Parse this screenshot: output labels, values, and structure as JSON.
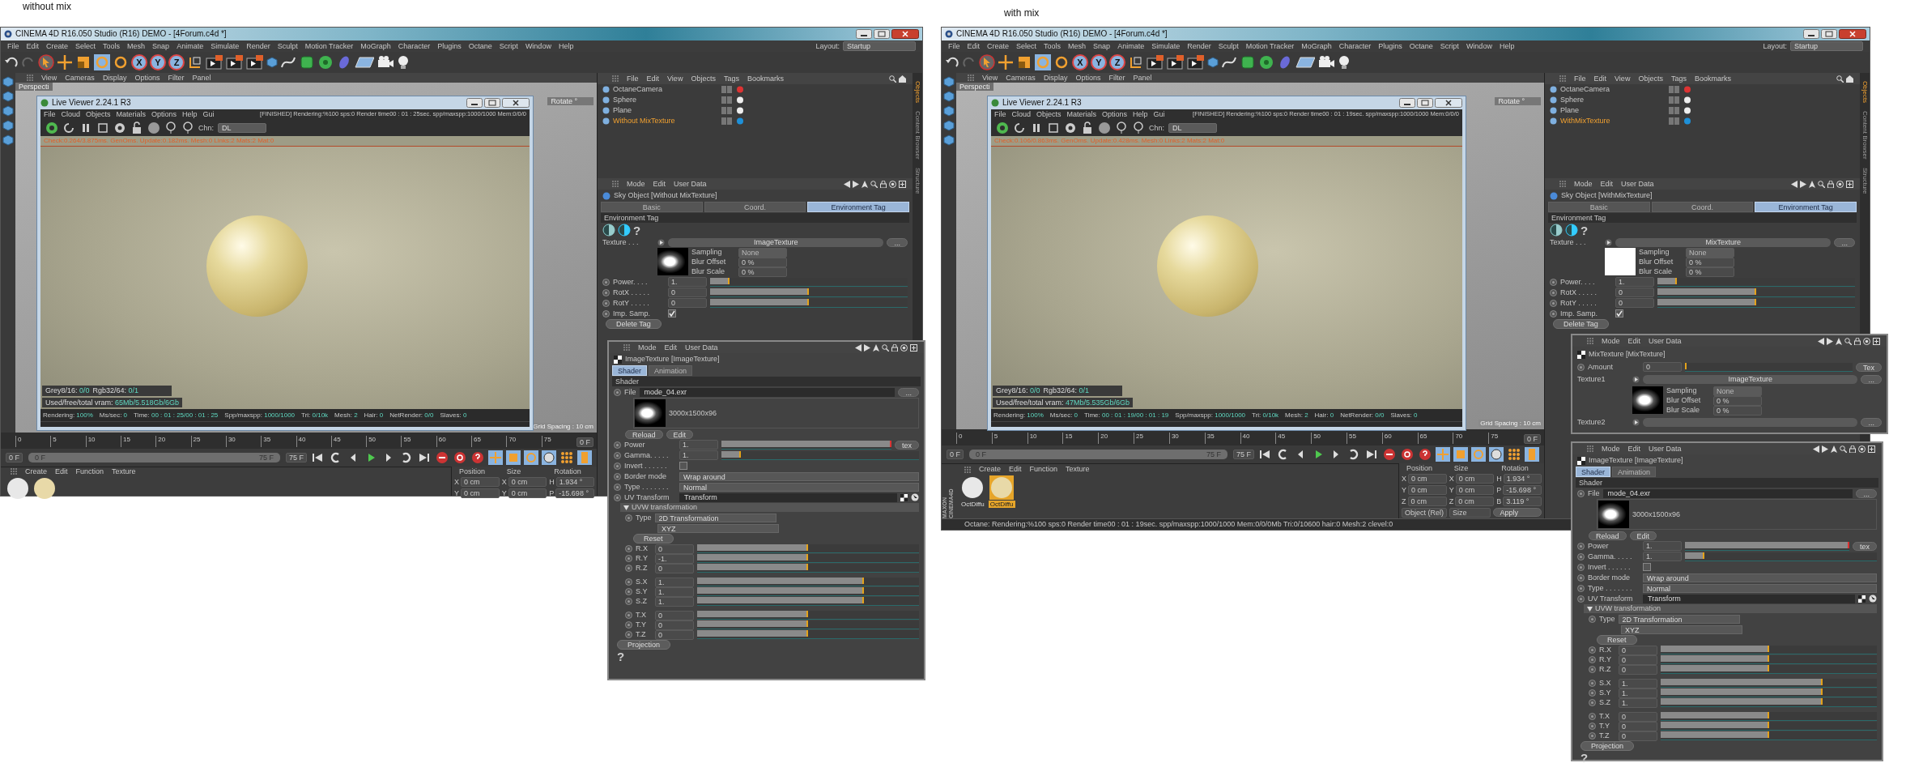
{
  "sides": [
    {
      "caption": "without mix",
      "window": {
        "title": "CINEMA 4D R16.050 Studio (R16) DEMO - [4Forum.c4d *]"
      },
      "menu": [
        "File",
        "Edit",
        "Create",
        "Select",
        "Tools",
        "Mesh",
        "Snap",
        "Animate",
        "Simulate",
        "Render",
        "Sculpt",
        "Motion Tracker",
        "MoGraph",
        "Character",
        "Plugins",
        "Octane",
        "Script",
        "Window",
        "Help"
      ],
      "layout": {
        "label": "Layout:",
        "value": "Startup"
      },
      "axes": [
        "X",
        "Y",
        "Z"
      ],
      "viewport": {
        "menu": [
          "View",
          "Cameras",
          "Display",
          "Options",
          "Filter",
          "Panel"
        ],
        "camera": "Perspecti",
        "hud": "Rotate °",
        "grid": "Grid Spacing : 10 cm"
      },
      "live_viewer": {
        "title": "Live Viewer 2.24.1 R3",
        "menu": [
          "File",
          "Cloud",
          "Objects",
          "Materials",
          "Options",
          "Help",
          "Gui"
        ],
        "status": "[FINISHED]  Rendering:%100 sps:0 Render time00 : 01 : 25sec. spp/maxspp:1000/1000 Mem:0/0/0",
        "channel_label": "Chn:",
        "channel": "DL",
        "log": "Check:0.264/3.875ms. GenOms. Update:0.182ms. Mesh:0 Links:2 Mats:2 Mat:0",
        "info": [
          {
            "label": "Grey8/16:",
            "value": "0/0"
          },
          {
            "label": "Rgb32/64:",
            "value": "0/1"
          }
        ],
        "vram": {
          "label": "Used/free/total vram:",
          "value": "65Mb/5.518Gb/6Gb"
        },
        "stats": [
          {
            "label": "Rendering:",
            "value": "100%"
          },
          {
            "label": "Ms/sec:",
            "value": "0"
          },
          {
            "label": "Time:",
            "value": "00 : 01 : 25/00 : 01 : 25"
          },
          {
            "label": "Spp/maxspp:",
            "value": "1000/1000"
          },
          {
            "label": "Tri:",
            "value": "0/10k"
          },
          {
            "label": "Mesh:",
            "value": "2"
          },
          {
            "label": "Hair:",
            "value": "0"
          },
          {
            "label": "NetRender:",
            "value": "0/0"
          },
          {
            "label": "Slaves:",
            "value": "0"
          }
        ]
      },
      "objects": {
        "menu": [
          "File",
          "Edit",
          "View",
          "Objects",
          "Tags",
          "Bookmarks"
        ],
        "items": [
          {
            "name": "OctaneCamera",
            "selected": false
          },
          {
            "name": "Sphere",
            "selected": false
          },
          {
            "name": "Plane",
            "selected": false
          },
          {
            "name": "Without MixTexture",
            "selected": true
          }
        ]
      },
      "side_tabs": [
        {
          "label": "Objects",
          "selected": true
        },
        {
          "label": "Content Browser",
          "selected": false
        },
        {
          "label": "Structure",
          "selected": false
        }
      ],
      "attributes": {
        "menu": [
          "Mode",
          "Edit",
          "User Data"
        ],
        "title": "Sky Object [Without MixTexture]",
        "tabs": [
          {
            "label": "Basic",
            "selected": false
          },
          {
            "label": "Coord.",
            "selected": false
          },
          {
            "label": "Environment Tag",
            "selected": true
          }
        ],
        "section": "Environment Tag",
        "help": "?",
        "texture": {
          "label": "Texture . . .",
          "value": "ImageTexture",
          "button": "...",
          "preview_blank": false
        },
        "sampling": [
          {
            "label": "Sampling",
            "value": "None",
            "kind": "dropdown"
          },
          {
            "label": "Blur Offset",
            "value": "0 %",
            "kind": "number"
          },
          {
            "label": "Blur Scale",
            "value": "0 %",
            "kind": "number"
          }
        ],
        "params": [
          {
            "label": "Power. . . .",
            "value": "1.",
            "level": 0.1
          },
          {
            "label": "RotX . . . . .",
            "value": "0",
            "level": 0.5
          },
          {
            "label": "RotY . . . . .",
            "value": "0",
            "level": 0.5
          }
        ],
        "imp_samp": {
          "label": "Imp. Samp.",
          "checked": true
        },
        "delete": "Delete Tag"
      },
      "timeline": {
        "ticks": [
          "0",
          "5",
          "10",
          "15",
          "20",
          "25",
          "30",
          "35",
          "40",
          "45",
          "50",
          "55",
          "60",
          "65",
          "70",
          "75"
        ],
        "current": "0 F",
        "start": "0 F",
        "range_start": "0 F",
        "range_end": "75 F",
        "end": "75 F",
        "range": {
          "level": 1
        }
      },
      "material_menu": [
        "Create",
        "Edit",
        "Function",
        "Texture"
      ],
      "materials": [
        {
          "selected": false
        },
        {
          "selected": false
        }
      ],
      "coordinates": {
        "headers": [
          "Position",
          "Size",
          "Rotation"
        ],
        "rows": [
          [
            {
              "axis": "X",
              "value": "0 cm"
            },
            {
              "axis": "X",
              "value": "0 cm"
            },
            {
              "axis": "H",
              "value": "1.934 °"
            }
          ],
          [
            {
              "axis": "Y",
              "value": "0 cm"
            },
            {
              "axis": "Y",
              "value": "0 cm"
            },
            {
              "axis": "P",
              "value": "-15.698 °"
            }
          ]
        ]
      },
      "panels": [
        {
          "kind": "image",
          "menu": [
            "Mode",
            "Edit",
            "User Data"
          ],
          "title": "ImageTexture [ImageTexture]",
          "tabs": [
            {
              "label": "Shader",
              "selected": true
            },
            {
              "label": "Animation",
              "selected": false
            }
          ],
          "section": "Shader",
          "file": {
            "label": "File",
            "value": "mode_04.exr",
            "button": "..."
          },
          "preview_caption": "3000x1500x96",
          "buttons": [
            "Reload",
            "Edit"
          ],
          "rows": [
            {
              "kind": "slider",
              "label": "Power",
              "value": "1.",
              "level": 1,
              "button": "tex"
            },
            {
              "kind": "slider",
              "label": "Gamma. . . . .",
              "value": "1.",
              "level": 0.1
            },
            {
              "kind": "checkbox",
              "label": "Invert . . . . . .",
              "checked": false
            },
            {
              "kind": "dropdown",
              "label": "Border mode",
              "value": "Wrap around"
            },
            {
              "kind": "dropdown",
              "label": "Type . . . . . . .",
              "value": "Normal"
            },
            {
              "kind": "link",
              "label": "UV Transform",
              "value": "Transform"
            }
          ],
          "group": {
            "title": "UVW transformation",
            "expanded": true,
            "type_label": "Type",
            "type": "2D Transformation",
            "order": "XYZ",
            "reset": "Reset",
            "rows": [
              {
                "label": "R.X",
                "value": "0",
                "level": 0.5
              },
              {
                "label": "R.Y",
                "value": "-1.",
                "level": 0.5
              },
              {
                "label": "R.Z",
                "value": "0",
                "level": 0.5
              },
              {
                "label": "S.X",
                "value": "1.",
                "level": 0.75
              },
              {
                "label": "S.Y",
                "value": "1.",
                "level": 0.75
              },
              {
                "label": "S.Z",
                "value": "1.",
                "level": 0.75
              },
              {
                "label": "T.X",
                "value": "0",
                "level": 0.5
              },
              {
                "label": "T.Y",
                "value": "0",
                "level": 0.5
              },
              {
                "label": "T.Z",
                "value": "0",
                "level": 0.5
              }
            ]
          },
          "projection": "Projection",
          "help": "?"
        }
      ]
    },
    {
      "caption": "with mix",
      "window": {
        "title": "CINEMA 4D R16.050 Studio (R16) DEMO - [4Forum.c4d *]"
      },
      "menu": [
        "File",
        "Edit",
        "Create",
        "Select",
        "Tools",
        "Mesh",
        "Snap",
        "Animate",
        "Simulate",
        "Render",
        "Sculpt",
        "Motion Tracker",
        "MoGraph",
        "Character",
        "Plugins",
        "Octane",
        "Script",
        "Window",
        "Help"
      ],
      "layout": {
        "label": "Layout:",
        "value": "Startup"
      },
      "axes": [
        "X",
        "Y",
        "Z"
      ],
      "viewport": {
        "menu": [
          "View",
          "Cameras",
          "Display",
          "Options",
          "Filter",
          "Panel"
        ],
        "camera": "Perspecti",
        "hud": "Rotate °",
        "grid": "Grid Spacing : 10 cm"
      },
      "live_viewer": {
        "title": "Live Viewer 2.24.1 R3",
        "menu": [
          "File",
          "Cloud",
          "Objects",
          "Materials",
          "Options",
          "Help",
          "Gui"
        ],
        "status": "[FINISHED]  Rendering:%100 sps:0 Render time00 : 01 : 19sec. spp/maxspp:1000/1000 Mem:0/0/0",
        "channel_label": "Chn:",
        "channel": "DL",
        "log": "Check:0.106/0.863ms. GenOms. Update:0.428ms. Mesh:0 Links:2 Mats:2 Mat:0",
        "info": [
          {
            "label": "Grey8/16:",
            "value": "0/0"
          },
          {
            "label": "Rgb32/64:",
            "value": "0/1"
          }
        ],
        "vram": {
          "label": "Used/free/total vram:",
          "value": "47Mb/5.535Gb/6Gb"
        },
        "stats": [
          {
            "label": "Rendering:",
            "value": "100%"
          },
          {
            "label": "Ms/sec:",
            "value": "0"
          },
          {
            "label": "Time:",
            "value": "00 : 01 : 19/00 : 01 : 19"
          },
          {
            "label": "Spp/maxspp:",
            "value": "1000/1000"
          },
          {
            "label": "Tri:",
            "value": "0/10k"
          },
          {
            "label": "Mesh:",
            "value": "2"
          },
          {
            "label": "Hair:",
            "value": "0"
          },
          {
            "label": "NetRender:",
            "value": "0/0"
          },
          {
            "label": "Slaves:",
            "value": "0"
          }
        ]
      },
      "objects": {
        "menu": [
          "File",
          "Edit",
          "View",
          "Objects",
          "Tags",
          "Bookmarks"
        ],
        "items": [
          {
            "name": "OctaneCamera",
            "selected": false
          },
          {
            "name": "Sphere",
            "selected": false
          },
          {
            "name": "Plane",
            "selected": false
          },
          {
            "name": "WithMixTexture",
            "selected": true
          }
        ]
      },
      "side_tabs": [
        {
          "label": "Objects",
          "selected": true
        },
        {
          "label": "Content Browser",
          "selected": false
        },
        {
          "label": "Structure",
          "selected": false
        }
      ],
      "attributes": {
        "menu": [
          "Mode",
          "Edit",
          "User Data"
        ],
        "title": "Sky Object [WithMixTexture]",
        "tabs": [
          {
            "label": "Basic",
            "selected": false
          },
          {
            "label": "Coord.",
            "selected": false
          },
          {
            "label": "Environment Tag",
            "selected": true
          }
        ],
        "section": "Environment Tag",
        "help": "?",
        "texture": {
          "label": "Texture . . .",
          "value": "MixTexture",
          "button": "...",
          "preview_blank": true
        },
        "sampling": [
          {
            "label": "Sampling",
            "value": "None",
            "kind": "dropdown"
          },
          {
            "label": "Blur Offset",
            "value": "0 %",
            "kind": "number"
          },
          {
            "label": "Blur Scale",
            "value": "0 %",
            "kind": "number"
          }
        ],
        "params": [
          {
            "label": "Power. . . .",
            "value": "1.",
            "level": 0.1
          },
          {
            "label": "RotX . . . . .",
            "value": "0",
            "level": 0.5
          },
          {
            "label": "RotY . . . . .",
            "value": "0",
            "level": 0.5
          }
        ],
        "imp_samp": {
          "label": "Imp. Samp.",
          "checked": true
        },
        "delete": "Delete Tag"
      },
      "timeline": {
        "ticks": [
          "0",
          "5",
          "10",
          "15",
          "20",
          "25",
          "30",
          "35",
          "40",
          "45",
          "50",
          "55",
          "60",
          "65",
          "70",
          "75"
        ],
        "current": "0 F",
        "start": "0 F",
        "range_start": "0 F",
        "range_end": "75 F",
        "end": "75 F",
        "range": {
          "level": 1
        }
      },
      "material_menu": [
        "Create",
        "Edit",
        "Function",
        "Texture"
      ],
      "materials": [
        {
          "label": "OctDiffu",
          "selected": false
        },
        {
          "label": "OctDiffu",
          "selected": true
        }
      ],
      "coordinates": {
        "headers": [
          "Position",
          "Size",
          "Rotation"
        ],
        "rows": [
          [
            {
              "axis": "X",
              "value": "0 cm"
            },
            {
              "axis": "X",
              "value": "0 cm"
            },
            {
              "axis": "H",
              "value": "1.934 °"
            }
          ],
          [
            {
              "axis": "Y",
              "value": "0 cm"
            },
            {
              "axis": "Y",
              "value": "0 cm"
            },
            {
              "axis": "P",
              "value": "-15.698 °"
            }
          ],
          [
            {
              "axis": "Z",
              "value": "0 cm"
            },
            {
              "axis": "Z",
              "value": "0 cm"
            },
            {
              "axis": "B",
              "value": "3.119 °"
            }
          ]
        ],
        "buttons": [
          {
            "kind": "dropdown",
            "label": "Object (Rel)"
          },
          {
            "kind": "dropdown",
            "label": "Size"
          },
          {
            "kind": "button",
            "label": "Apply"
          }
        ]
      },
      "brand": [
        "MAXON",
        "CINEMA4D"
      ],
      "status_bar": "Octane: Rendering:%100 sps:0 Render time00 : 01 : 19sec. spp/maxspp:1000/1000 Mem:0/0/0Mb Tri:0/10600 hair:0 Mesh:2 clevel:0",
      "panels": [
        {
          "kind": "mix",
          "menu": [
            "Mode",
            "Edit",
            "User Data"
          ],
          "title": "MixTexture [MixTexture]",
          "amount": {
            "label": "Amount",
            "value": "0",
            "level": 0,
            "button": "Tex"
          },
          "texture1": {
            "label": "Texture1",
            "value": "ImageTexture",
            "button": "..."
          },
          "sampling": [
            {
              "label": "Sampling",
              "value": "None",
              "kind": "dropdown"
            },
            {
              "label": "Blur Offset",
              "value": "0 %",
              "kind": "number"
            },
            {
              "label": "Blur Scale",
              "value": "0 %",
              "kind": "number"
            }
          ],
          "texture2": {
            "label": "Texture2",
            "button": "..."
          }
        },
        {
          "kind": "image",
          "menu": [
            "Mode",
            "Edit",
            "User Data"
          ],
          "title": "ImageTexture [ImageTexture]",
          "tabs": [
            {
              "label": "Shader",
              "selected": true
            },
            {
              "label": "Animation",
              "selected": false
            }
          ],
          "section": "Shader",
          "file": {
            "label": "File",
            "value": "mode_04.exr",
            "button": "..."
          },
          "preview_caption": "3000x1500x96",
          "buttons": [
            "Reload",
            "Edit"
          ],
          "rows": [
            {
              "kind": "slider",
              "label": "Power",
              "value": "1.",
              "level": 1,
              "button": "tex"
            },
            {
              "kind": "slider",
              "label": "Gamma. . . . .",
              "value": "1.",
              "level": 0.1
            },
            {
              "kind": "checkbox",
              "label": "Invert . . . . . .",
              "checked": false
            },
            {
              "kind": "dropdown",
              "label": "Border mode",
              "value": "Wrap around"
            },
            {
              "kind": "dropdown",
              "label": "Type . . . . . . .",
              "value": "Normal"
            },
            {
              "kind": "link",
              "label": "UV Transform",
              "value": "Transform"
            }
          ],
          "group": {
            "title": "UVW transformation",
            "expanded": true,
            "type_label": "Type",
            "type": "2D Transformation",
            "order": "XYZ",
            "reset": "Reset",
            "rows": [
              {
                "label": "R.X",
                "value": "0",
                "level": 0.5
              },
              {
                "label": "R.Y",
                "value": "0",
                "level": 0.5
              },
              {
                "label": "R.Z",
                "value": "0",
                "level": 0.5
              },
              {
                "label": "S.X",
                "value": "1.",
                "level": 0.75
              },
              {
                "label": "S.Y",
                "value": "1.",
                "level": 0.75
              },
              {
                "label": "S.Z",
                "value": "1.",
                "level": 0.75
              },
              {
                "label": "T.X",
                "value": "0",
                "level": 0.5
              },
              {
                "label": "T.Y",
                "value": "0",
                "level": 0.5
              },
              {
                "label": "T.Z",
                "value": "0",
                "level": 0.5
              }
            ]
          },
          "projection": "Projection",
          "help": "?"
        }
      ]
    }
  ]
}
